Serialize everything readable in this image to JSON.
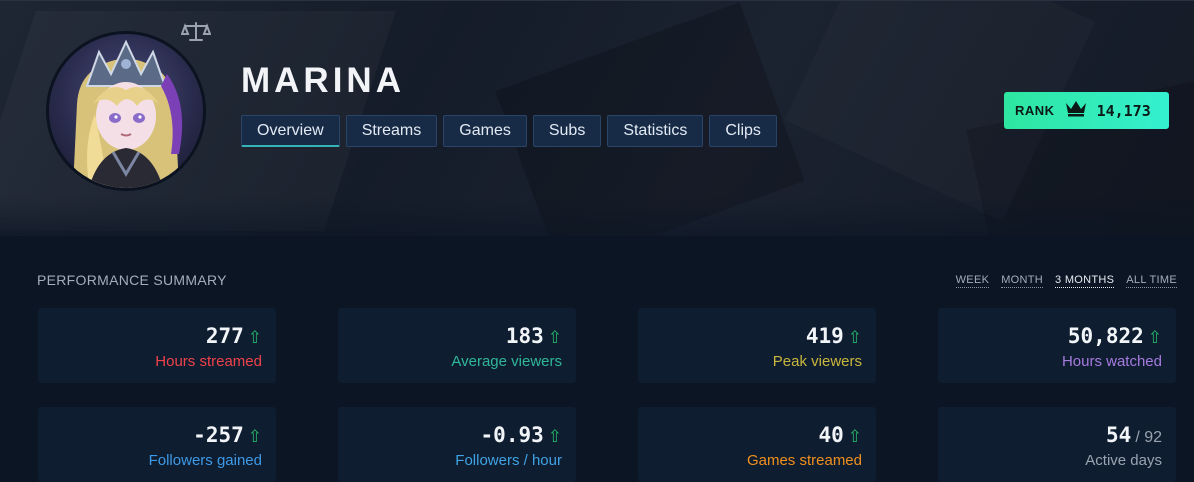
{
  "channel": {
    "name": "MARINA"
  },
  "tabs": [
    {
      "label": "Overview",
      "active": true
    },
    {
      "label": "Streams",
      "active": false
    },
    {
      "label": "Games",
      "active": false
    },
    {
      "label": "Subs",
      "active": false
    },
    {
      "label": "Statistics",
      "active": false
    },
    {
      "label": "Clips",
      "active": false
    }
  ],
  "rank": {
    "label": "RANK",
    "icon": "crown-icon",
    "value": "14,173"
  },
  "summary": {
    "title": "PERFORMANCE SUMMARY",
    "periods": [
      {
        "label": "WEEK",
        "active": false
      },
      {
        "label": "MONTH",
        "active": false
      },
      {
        "label": "3 MONTHS",
        "active": true
      },
      {
        "label": "ALL TIME",
        "active": false
      }
    ],
    "cards": [
      {
        "value": "277",
        "arrow": "⇧",
        "label": "Hours streamed",
        "color": "#f0424a"
      },
      {
        "value": "183",
        "arrow": "⇧",
        "label": "Average viewers",
        "color": "#2fb79a"
      },
      {
        "value": "419",
        "arrow": "⇧",
        "label": "Peak viewers",
        "color": "#c9b63c"
      },
      {
        "value": "50,822",
        "arrow": "⇧",
        "label": "Hours watched",
        "color": "#a67be0"
      },
      {
        "value": "-257",
        "arrow": "⇧",
        "label": "Followers gained",
        "color": "#3d9ae8"
      },
      {
        "value": "-0.93",
        "arrow": "⇧",
        "label": "Followers / hour",
        "color": "#3fa3e6"
      },
      {
        "value": "40",
        "arrow": "⇧",
        "label": "Games streamed",
        "color": "#f0901e"
      },
      {
        "value": "54",
        "total": "/ 92",
        "label": "Active days",
        "color": "#9aa3b0"
      }
    ]
  },
  "colors": {
    "background": "#0b1524",
    "card": "#0f1d30",
    "tab": "#172b46",
    "rank_gradient_start": "#2ee6a0",
    "rank_gradient_end": "#35f0d0",
    "arrow_up": "#23b56a"
  }
}
